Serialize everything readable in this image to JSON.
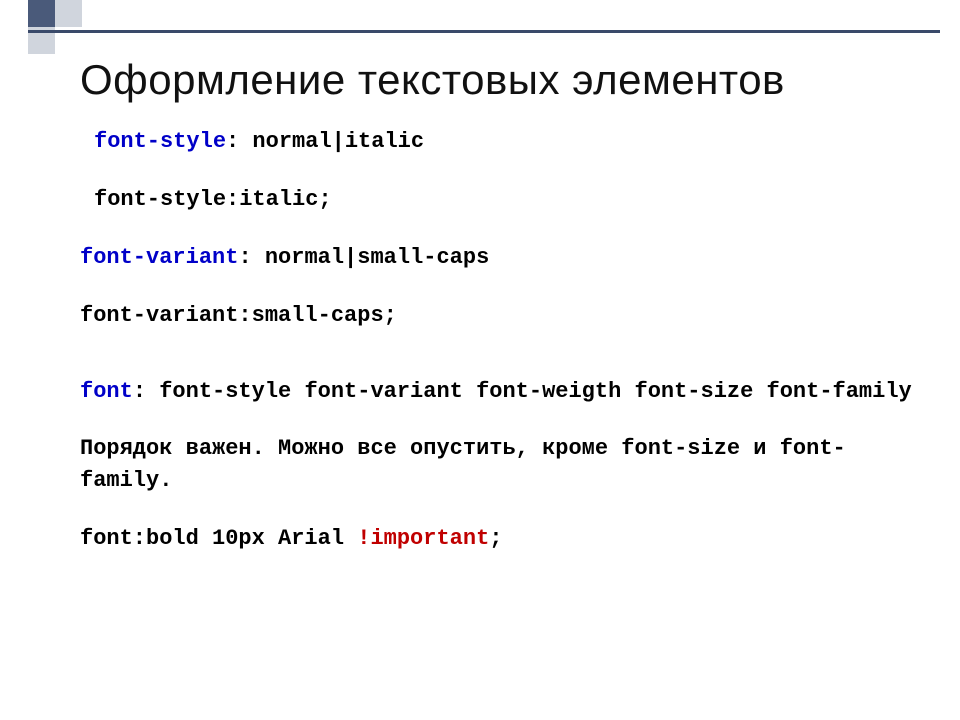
{
  "title": "Оформление текстовых элементов",
  "lines": {
    "l1_prop": "font-style",
    "l1_rest": ": normal|italic",
    "l2": "font-style:italic;",
    "l3_prop": "font-variant",
    "l3_rest": ": normal|small-caps",
    "l4": "font-variant:small-caps;",
    "l5_prop": "font",
    "l5_rest": ": font-style font-variant font-weigth  font-size font-family",
    "l6": "Порядок важен. Можно все опустить, кроме font-size и font-family.",
    "l7_a": "font:bold 10px Arial ",
    "l7_imp": "!important",
    "l7_b": ";"
  }
}
